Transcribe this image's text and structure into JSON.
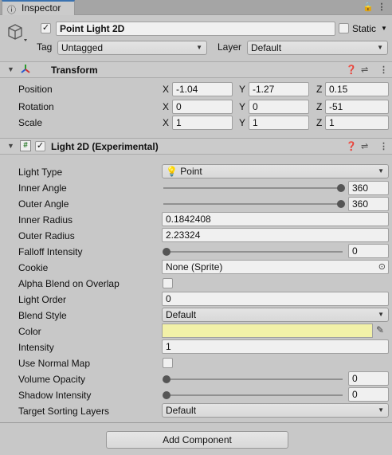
{
  "tab": {
    "label": "Inspector"
  },
  "object": {
    "name": "Point Light 2D",
    "active_checked": true,
    "static_label": "Static",
    "tag_label": "Tag",
    "tag_value": "Untagged",
    "layer_label": "Layer",
    "layer_value": "Default"
  },
  "transform": {
    "title": "Transform",
    "rows": [
      {
        "label": "Position",
        "x": "-1.04",
        "y": "-1.27",
        "z": "0.15"
      },
      {
        "label": "Rotation",
        "x": "0",
        "y": "0",
        "z": "-51"
      },
      {
        "label": "Scale",
        "x": "1",
        "y": "1",
        "z": "1"
      }
    ],
    "axis_x": "X",
    "axis_y": "Y",
    "axis_z": "Z"
  },
  "light": {
    "title": "Light 2D (Experimental)",
    "light_type_label": "Light Type",
    "light_type_value": "Point",
    "inner_angle_label": "Inner Angle",
    "inner_angle_value": "360",
    "outer_angle_label": "Outer Angle",
    "outer_angle_value": "360",
    "inner_radius_label": "Inner Radius",
    "inner_radius_value": "0.1842408",
    "outer_radius_label": "Outer Radius",
    "outer_radius_value": "2.23324",
    "falloff_label": "Falloff Intensity",
    "falloff_value": "0",
    "cookie_label": "Cookie",
    "cookie_value": "None (Sprite)",
    "alpha_blend_label": "Alpha Blend on Overlap",
    "light_order_label": "Light Order",
    "light_order_value": "0",
    "blend_style_label": "Blend Style",
    "blend_style_value": "Default",
    "color_label": "Color",
    "color_value": "#f2f1a8",
    "intensity_label": "Intensity",
    "intensity_value": "1",
    "normal_map_label": "Use Normal Map",
    "volume_label": "Volume Opacity",
    "volume_value": "0",
    "shadow_label": "Shadow Intensity",
    "shadow_value": "0",
    "sorting_label": "Target Sorting Layers",
    "sorting_value": "Default"
  },
  "add_component_label": "Add Component"
}
